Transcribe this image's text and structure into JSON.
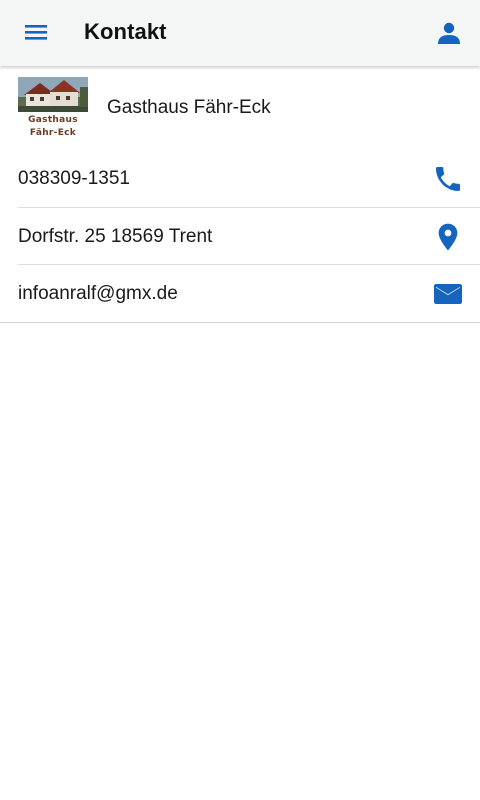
{
  "app": {
    "title": "Kontakt",
    "accent_color": "#1565c0"
  },
  "icons": {
    "menu": "menu-icon",
    "user": "person-icon",
    "phone": "phone-icon",
    "location": "location-pin-icon",
    "email": "envelope-icon"
  },
  "business": {
    "name": "Gasthaus Fähr-Eck",
    "logo_line1": "Gasthaus",
    "logo_line2": "Fähr-Eck"
  },
  "contacts": [
    {
      "type": "phone",
      "value": "038309-1351"
    },
    {
      "type": "address",
      "value": "Dorfstr. 25 18569 Trent"
    },
    {
      "type": "email",
      "value": "infoanralf@gmx.de"
    }
  ]
}
